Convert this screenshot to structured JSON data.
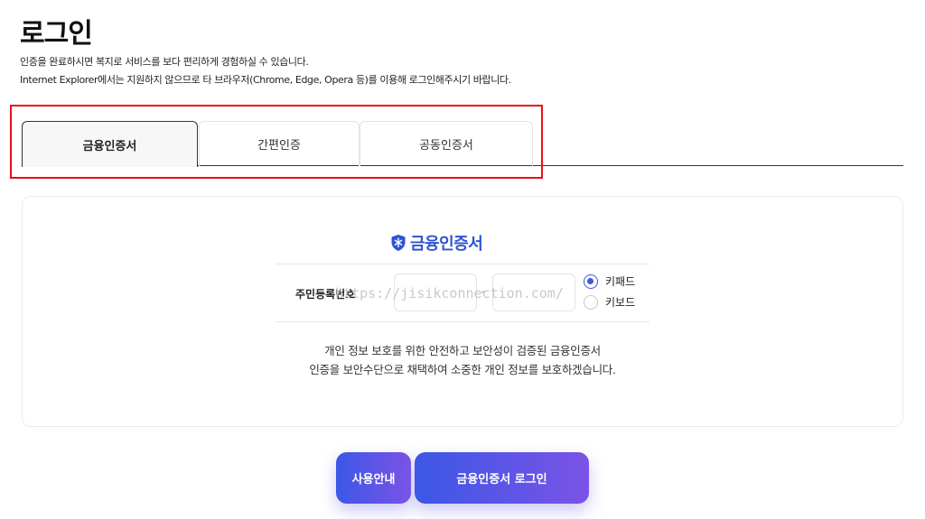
{
  "page": {
    "title": "로그인",
    "desc_line1": "인증을 완료하시면 복지로 서비스를 보다 편리하게 경험하실 수 있습니다.",
    "desc_line2": "Internet Explorer에서는 지원하지 않으므로 타 브라우저(Chrome, Edge, Opera 등)를 이용해 로그인해주시기 바랍니다."
  },
  "tabs": [
    {
      "label": "금융인증서",
      "active": true
    },
    {
      "label": "간편인증",
      "active": false
    },
    {
      "label": "공동인증서",
      "active": false
    }
  ],
  "panel": {
    "heading": "금융인증서",
    "form_label": "주민등록번호",
    "rrn_separator": "-",
    "rrn_front_value": "",
    "rrn_back_value": "",
    "keyboard_options": [
      {
        "label": "키패드",
        "selected": true
      },
      {
        "label": "키보드",
        "selected": false
      }
    ],
    "info_line1": "개인 정보 보호를 위한 안전하고 보안성이 검증된 금융인증서",
    "info_line2": "인증을 보안수단으로 채택하여 소중한 개인 정보를 보호하겠습니다."
  },
  "watermark": "https://jisikconnection.com/",
  "buttons": {
    "guide": "사용안내",
    "login": "금융인증서 로그인"
  },
  "colors": {
    "accent": "#2f53d3",
    "highlight_border": "#e8101a",
    "button_gradient_start": "#3c57e6",
    "button_gradient_end": "#7b53e6"
  },
  "icons": {
    "cert_heading_icon": "shield-icon"
  }
}
